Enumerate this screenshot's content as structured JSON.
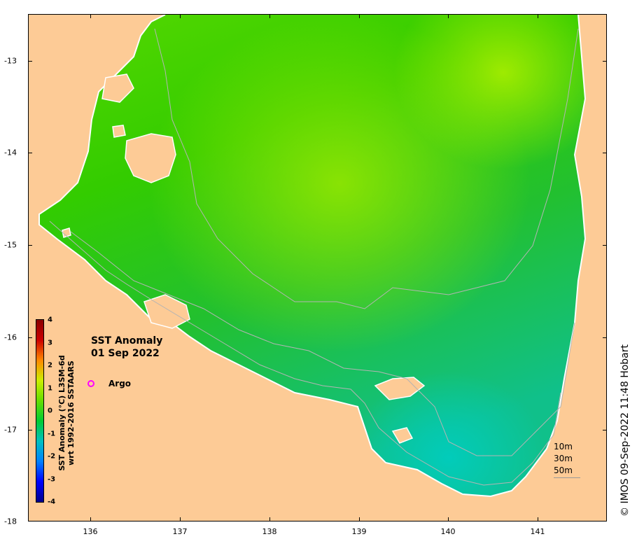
{
  "map": {
    "title_line1": "SST Anomaly",
    "title_line2": "01 Sep 2022",
    "credit": "© IMOS 09-Sep-2022 11:48 Hobart",
    "colors": {
      "land": "#fdcb96",
      "coast": "#ffffff",
      "isobath": "#b4b4b4",
      "argo": "#ff00ff"
    }
  },
  "axes": {
    "y_ticks": [
      "-13",
      "-14",
      "-15",
      "-16",
      "-17",
      "-18"
    ],
    "x_ticks": [
      "136",
      "137",
      "138",
      "139",
      "140",
      "141"
    ]
  },
  "legend": {
    "argo_label": "Argo",
    "depth_labels": [
      "10m",
      "30m",
      "50m"
    ]
  },
  "colorbar": {
    "ticks": [
      "4",
      "3",
      "2",
      "1",
      "0",
      "-1",
      "-2",
      "-3",
      "-4"
    ],
    "label_line1": "SST Anomaly (°C) L3SM-6d",
    "label_line2": "wrt 1992-2016 SSTAARS",
    "range": [
      -4,
      4
    ],
    "stops": [
      "#00008b",
      "#0000ff",
      "#0080ff",
      "#00c0c0",
      "#00cc33",
      "#66dd00",
      "#ccee00",
      "#ff8800",
      "#cc0000",
      "#8b0000"
    ]
  }
}
